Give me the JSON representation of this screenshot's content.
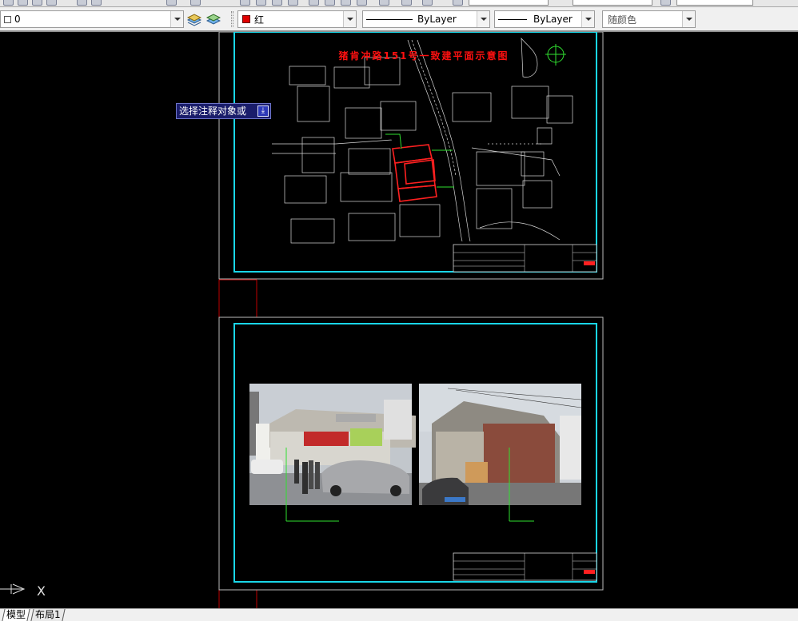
{
  "toolbar": {
    "layer_name": "0",
    "color_name": "红",
    "linetype_name": "ByLayer",
    "lineweight_name": "ByLayer",
    "plotstyle_name": "随颜色"
  },
  "tooltip": {
    "text": "选择注释对象或"
  },
  "sheet1": {
    "title": "猪肯冲路151号一致建平面示意图"
  },
  "tabs": {
    "model": "模型",
    "layout1": "布局1"
  },
  "ucs": {
    "axis_label": "X"
  },
  "colors": {
    "cyan_frame": "#19d6e8",
    "title_red": "#ff1010",
    "outline_red": "#ff2020",
    "leader_green": "#30e030",
    "tooltip_bg": "#1a1d6b"
  }
}
